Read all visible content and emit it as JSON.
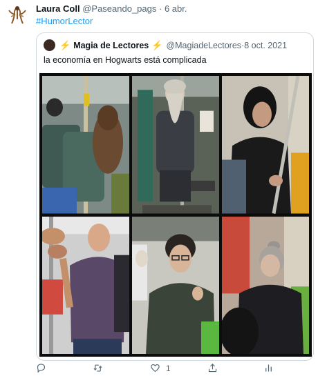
{
  "tweet": {
    "author_name": "Laura Coll",
    "handle": "@Paseando_pags",
    "separator": " · ",
    "date": "6 abr.",
    "hashtag": "#HumorLector",
    "avatar_icon": "figure-drawing-avatar"
  },
  "quoted": {
    "bolt": "⚡",
    "author_name": "Magia de Lectores",
    "handle": "@MagiadeLectores",
    "separator": " · ",
    "date": "8 oct. 2021",
    "text": "la economía en Hogwarts está complicada"
  },
  "photos": [
    "metro-passenger-long-hair-photo",
    "metro-passenger-grey-beard-photo",
    "metro-passenger-dark-hair-woman-photo",
    "metro-passenger-bald-man-photo",
    "metro-passenger-glasses-boy-photo",
    "metro-passenger-grey-bun-woman-photo"
  ],
  "actions": {
    "reply_icon": "reply-icon",
    "retweet_icon": "retweet-icon",
    "like_icon": "heart-icon",
    "like_count": "1",
    "share_icon": "share-icon",
    "analytics_icon": "analytics-icon"
  },
  "colors": {
    "link": "#1d9bf0",
    "secondary_text": "#536471",
    "border": "#cfd9de",
    "bolt": "#f5b800"
  }
}
